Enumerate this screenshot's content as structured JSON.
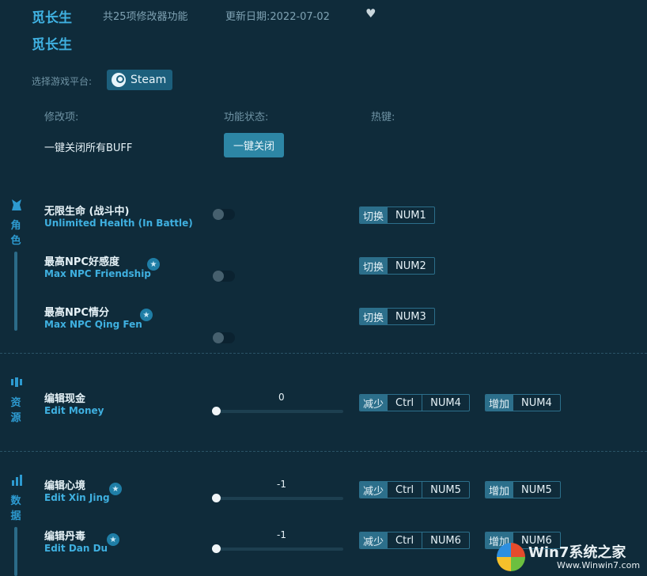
{
  "header": {
    "title": "觅长生",
    "feature_count": "共25项修改器功能",
    "update_date": "更新日期:2022-07-02",
    "subtitle": "觅长生"
  },
  "platform": {
    "label": "选择游戏平台:",
    "steam_label": "Steam"
  },
  "columns": {
    "feature": "修改项:",
    "status": "功能状态:",
    "hotkey": "热键:"
  },
  "buff": {
    "label": "一键关闭所有BUFF",
    "button": "一键关闭"
  },
  "sections": {
    "character": "角色",
    "resources": "资源",
    "data": "数据"
  },
  "character_features": [
    {
      "zh": "无限生命 (战斗中)",
      "en": "Unlimited Health (In Battle)",
      "tag": "切换",
      "key": "NUM1",
      "starred": false
    },
    {
      "zh": "最高NPC好感度",
      "en": "Max NPC Friendship",
      "tag": "切换",
      "key": "NUM2",
      "starred": true
    },
    {
      "zh": "最高NPC情分",
      "en": "Max NPC Qing Fen",
      "tag": "切换",
      "key": "NUM3",
      "starred": true
    }
  ],
  "resource_features": [
    {
      "zh": "编辑现金",
      "en": "Edit Money",
      "value": "0",
      "dec_tag": "减少",
      "dec_mod": "Ctrl",
      "dec_key": "NUM4",
      "inc_tag": "增加",
      "inc_key": "NUM4",
      "starred": false
    }
  ],
  "data_features": [
    {
      "zh": "编辑心境",
      "en": "Edit Xin Jing",
      "value": "-1",
      "dec_tag": "减少",
      "dec_mod": "Ctrl",
      "dec_key": "NUM5",
      "inc_tag": "增加",
      "inc_key": "NUM5",
      "starred": true
    },
    {
      "zh": "编辑丹毒",
      "en": "Edit Dan Du",
      "value": "-1",
      "dec_tag": "减少",
      "dec_mod": "Ctrl",
      "dec_key": "NUM6",
      "inc_tag": "增加",
      "inc_key": "NUM6",
      "starred": true
    }
  ],
  "watermark": {
    "text": "Win7系统之家",
    "url": "Www.Winwin7.com"
  },
  "icons": {
    "favorite": "heart-icon",
    "steam": "steam-icon",
    "star": "star-icon",
    "character": "character-icon",
    "resources": "resources-icon",
    "data": "data-icon"
  },
  "colors": {
    "background": "#0f2b3a",
    "accent": "#3fb0e0",
    "button": "#2d86a5",
    "hotkey_tag": "#2c6f8b"
  }
}
